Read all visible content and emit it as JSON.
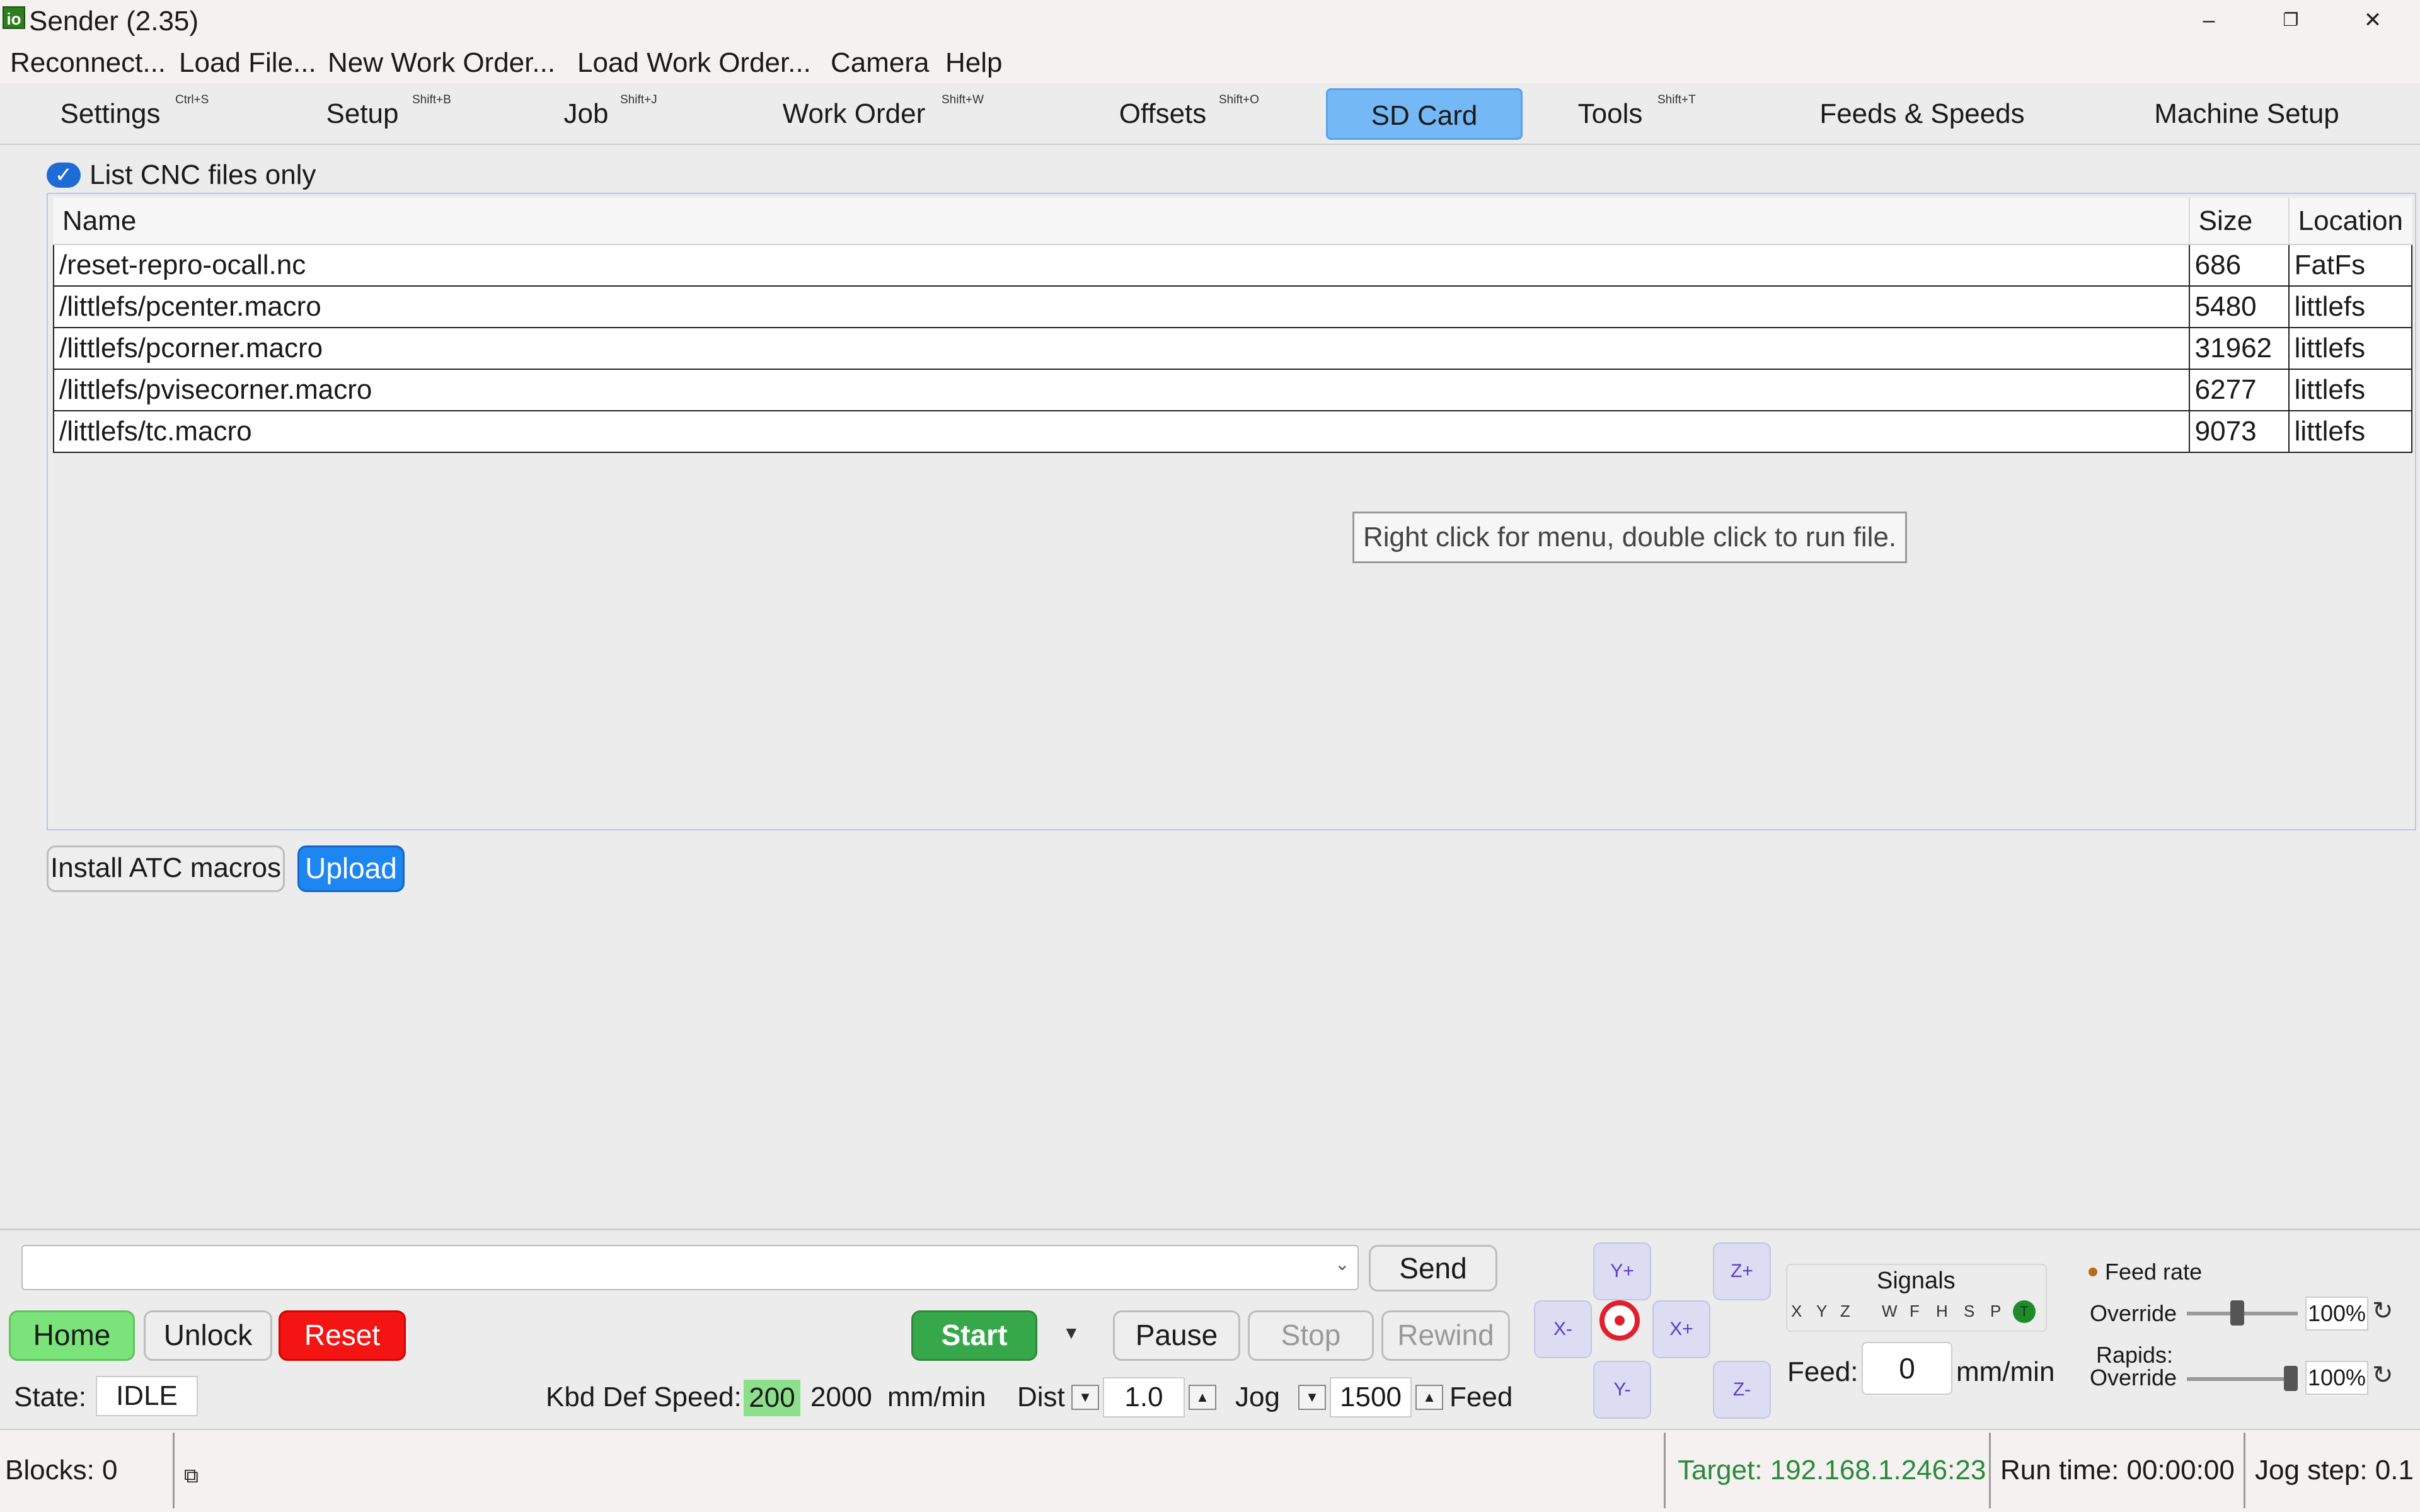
{
  "window": {
    "icon": "io",
    "title": "Sender (2.35)",
    "controls": [
      "–",
      "❐",
      "✕"
    ]
  },
  "menu": [
    "Reconnect...",
    "Load File...",
    "New Work Order...",
    "Load Work Order...",
    "Camera",
    "Help"
  ],
  "tabs": [
    {
      "label": "Settings",
      "shortcut": "Ctrl+S"
    },
    {
      "label": "Setup",
      "shortcut": "Shift+B"
    },
    {
      "label": "Job",
      "shortcut": "Shift+J"
    },
    {
      "label": "Work Order",
      "shortcut": "Shift+W"
    },
    {
      "label": "Offsets",
      "shortcut": "Shift+O"
    },
    {
      "label": "SD Card",
      "shortcut": "",
      "active": true
    },
    {
      "label": "Tools",
      "shortcut": "Shift+T"
    },
    {
      "label": "Feeds & Speeds",
      "shortcut": ""
    },
    {
      "label": "Machine Setup",
      "shortcut": ""
    }
  ],
  "sdcard": {
    "filter_label": "List CNC files only",
    "filter_checked": true,
    "columns": [
      "Name",
      "Size",
      "Location"
    ],
    "rows": [
      [
        "/reset-repro-ocall.nc",
        "686",
        "FatFs"
      ],
      [
        "/littlefs/pcenter.macro",
        "5480",
        "littlefs"
      ],
      [
        "/littlefs/pcorner.macro",
        "31962",
        "littlefs"
      ],
      [
        "/littlefs/pvisecorner.macro",
        "6277",
        "littlefs"
      ],
      [
        "/littlefs/tc.macro",
        "9073",
        "littlefs"
      ]
    ],
    "tooltip": "Right click for menu, double click to run file.",
    "install_label": "Install ATC macros",
    "upload_label": "Upload"
  },
  "controls": {
    "command_value": "",
    "send_label": "Send",
    "home_label": "Home",
    "unlock_label": "Unlock",
    "reset_label": "Reset",
    "start_label": "Start",
    "pause_label": "Pause",
    "stop_label": "Stop",
    "rewind_label": "Rewind",
    "state_label": "State:",
    "state_value": "IDLE",
    "kbd_label": "Kbd Def Speed:",
    "kbd_speed": "200",
    "kbd_speed2": "2000",
    "kbd_units": "mm/min",
    "dist_label": "Dist",
    "dist_value": "1.0",
    "jog_label": "Jog",
    "jog_value": "1500",
    "feed_label": "Feed"
  },
  "jog": {
    "y_plus": "Y+",
    "y_minus": "Y-",
    "x_minus": "X-",
    "x_plus": "X+",
    "z_plus": "Z+",
    "z_minus": "Z-"
  },
  "signals": {
    "label": "Signals",
    "items": [
      "X",
      "Y",
      "Z",
      "W",
      "F",
      "H",
      "S",
      "P",
      "T"
    ],
    "active_color": "#1e8a2a"
  },
  "feed": {
    "label": "Feed:",
    "value": "0",
    "units": "mm/min"
  },
  "override": {
    "feed_title": "Feed rate",
    "feed_label": "Override",
    "feed_value": "100%",
    "feed_level": 0.45,
    "rapids_label1": "Rapids:",
    "rapids_label2": "Override",
    "rapids_value": "100%",
    "rapids_level": 1.0
  },
  "status": {
    "blocks": "Blocks: 0",
    "target": "Target: 192.168.1.246:23",
    "target_color": "#2a8a3a",
    "runtime": "Run time: 00:00:00",
    "jogstep": "Jog step: 0.1"
  }
}
